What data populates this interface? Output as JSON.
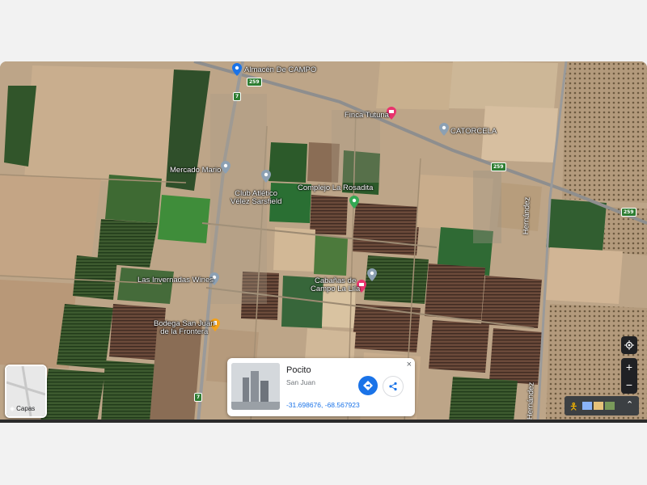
{
  "map": {
    "type": "satellite",
    "layers_label": "Capas",
    "pois": [
      {
        "label": "Almacén De CAMPO",
        "icon": "shopping-pin-icon"
      },
      {
        "label": "Finca Tutuna",
        "icon": "lodging-pin-icon"
      },
      {
        "label": "CATORCELA",
        "icon": "place-pin-icon"
      },
      {
        "label": "Mercado Mario",
        "icon": "place-pin-icon"
      },
      {
        "label": "Club Atlético\nVélez Sarsfield",
        "icon": "place-pin-icon"
      },
      {
        "label": "Complejo La Rosadita",
        "icon": "park-pin-icon"
      },
      {
        "label": "Las Invernadas Wines",
        "icon": "place-pin-icon"
      },
      {
        "label": "Cabañas de\nCampo La Lila",
        "icon": "lodging-pin-icon"
      },
      {
        "label": "Bodega San Juan\nde la Frontera",
        "icon": "winery-pin-icon"
      }
    ],
    "road_shields": [
      "259",
      "259",
      "259",
      "7",
      "7"
    ],
    "road_names": [
      "Hernández",
      "Hernández"
    ]
  },
  "info_card": {
    "title": "Pocito",
    "subtitle": "San Juan",
    "coordinates": "-31.698676, -68.567923",
    "close_label": "×"
  },
  "controls": {
    "zoom_in": "+",
    "zoom_out": "−",
    "expand": "⌃"
  },
  "colors": {
    "accent": "#1a73e8",
    "lodging_pin": "#e8336d",
    "park_pin": "#34a853",
    "winery_pin": "#f4a21a",
    "place_pin": "#8ca0b3"
  }
}
